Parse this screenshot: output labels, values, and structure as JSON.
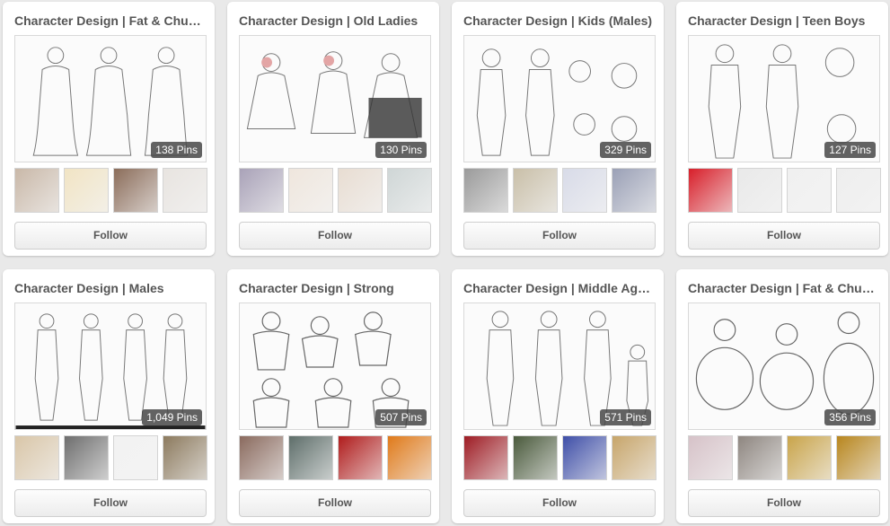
{
  "boards": [
    {
      "title": "Character Design | Fat & Chu…",
      "pin_count": "138 Pins",
      "follow_label": "Follow",
      "thumb_colors": [
        "#c9b8a8",
        "#f1e4c4",
        "#8b6d5a",
        "#e8e4e0"
      ]
    },
    {
      "title": "Character Design | Old Ladies",
      "pin_count": "130 Pins",
      "follow_label": "Follow",
      "thumb_colors": [
        "#a9a2b8",
        "#efe6dd",
        "#e8ddd2",
        "#cfd6d6"
      ]
    },
    {
      "title": "Character Design | Kids (Males)",
      "pin_count": "329 Pins",
      "follow_label": "Follow",
      "thumb_colors": [
        "#9a9a9a",
        "#c9bfa8",
        "#d8dbe8",
        "#9aa0b6"
      ]
    },
    {
      "title": "Character Design | Teen Boys",
      "pin_count": "127 Pins",
      "follow_label": "Follow",
      "thumb_colors": [
        "#d81f2a",
        "#e9e9e9",
        "#f0f0f0",
        "#eeeeee"
      ]
    },
    {
      "title": "Character Design | Males",
      "pin_count": "1,049 Pins",
      "follow_label": "Follow",
      "thumb_colors": [
        "#d9c6a8",
        "#6e6e6e",
        "#f2f2f2",
        "#8c7a5e"
      ]
    },
    {
      "title": "Character Design | Strong",
      "pin_count": "507 Pins",
      "follow_label": "Follow",
      "thumb_colors": [
        "#8a6a5e",
        "#5e6e6a",
        "#b01c1c",
        "#e07a1a"
      ]
    },
    {
      "title": "Character Design | Middle Ag…",
      "pin_count": "571 Pins",
      "follow_label": "Follow",
      "thumb_colors": [
        "#9e1c24",
        "#4a5a3c",
        "#3f4fa8",
        "#c7a56a"
      ]
    },
    {
      "title": "Character Design | Fat & Chu…",
      "pin_count": "356 Pins",
      "follow_label": "Follow",
      "thumb_colors": [
        "#d6c2c8",
        "#8e8680",
        "#c9a44a",
        "#b8861e"
      ]
    }
  ]
}
